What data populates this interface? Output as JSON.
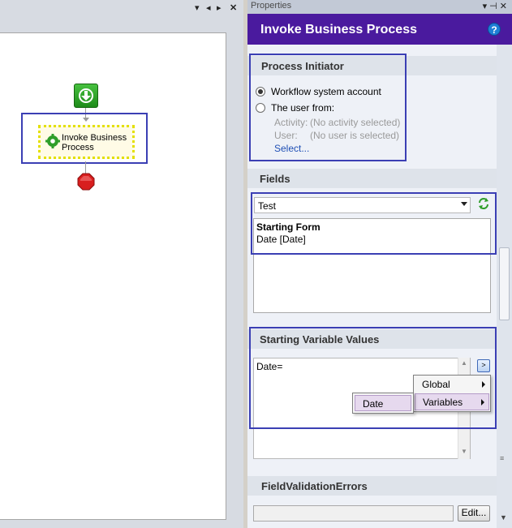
{
  "designer": {
    "toolbar_glyphs": [
      "▾",
      "◂",
      "▸",
      "✕"
    ],
    "activity_label": "Invoke Business Process"
  },
  "properties": {
    "pane_title": "Properties",
    "pane_glyphs": "▾ ⊣ ✕",
    "header_title": "Invoke Business Process",
    "help_glyph": "?",
    "process_initiator": {
      "title": "Process Initiator",
      "option_system": "Workflow system account",
      "option_user": "The user from:",
      "activity_label": "Activity:",
      "activity_value": "(No activity selected)",
      "user_label": "User:",
      "user_value": "(No user is selected)",
      "select_link": "Select..."
    },
    "fields": {
      "title": "Fields",
      "selected_process": "Test",
      "form_title": "Starting Form",
      "form_field": "Date [Date]"
    },
    "starting_variables": {
      "title": "Starting Variable Values",
      "text_value": "Date=",
      "insert_button": ">",
      "context_menu": [
        {
          "label": "Global",
          "has_submenu": true
        },
        {
          "label": "Variables",
          "has_submenu": true
        }
      ],
      "submenu_item": "Date"
    },
    "validation": {
      "title": "FieldValidationErrors",
      "value": "",
      "edit_button": "Edit..."
    }
  },
  "colors": {
    "header_bg": "#4a1a9e",
    "highlight_border": "#3b3fb4",
    "start_green": "#2aa524",
    "stop_red": "#d81e1e"
  },
  "icons": [
    "start-arrow-icon",
    "gear-icon",
    "stop-icon",
    "help-icon",
    "refresh-icon",
    "chevron-down-icon"
  ]
}
